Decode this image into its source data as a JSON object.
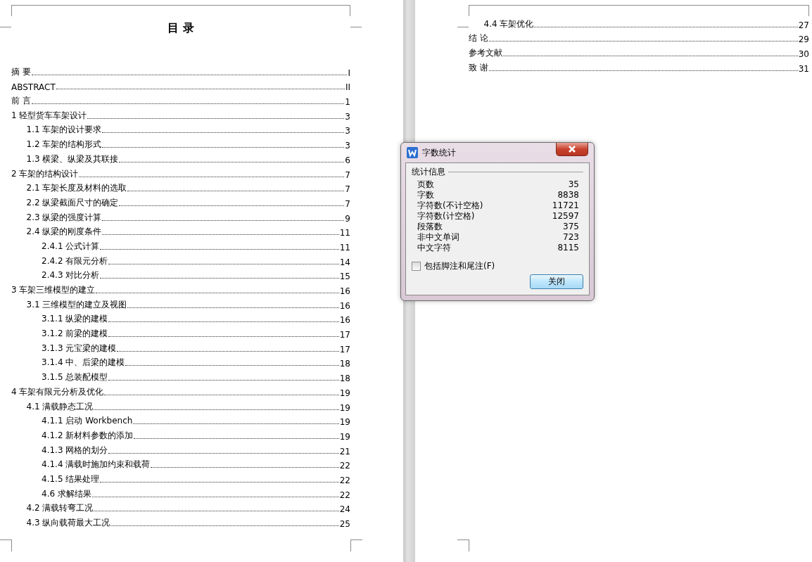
{
  "pages": [
    {
      "title": "目 录",
      "entries": [
        {
          "label": "摘 要",
          "page": "I"
        },
        {
          "label": "ABSTRACT",
          "page": "II"
        },
        {
          "label": "前 言",
          "page": "1"
        },
        {
          "label": "1 轻型货车车架设计",
          "page": "3",
          "children": [
            {
              "label": "1.1 车架的设计要求",
              "page": "3"
            },
            {
              "label": "1.2 车架的结构形式",
              "page": "3"
            },
            {
              "label": "1.3 横梁、纵梁及其联接",
              "page": "6"
            }
          ]
        },
        {
          "label": "2 车架的结构设计",
          "page": "7",
          "children": [
            {
              "label": "2.1 车架长度及材料的选取",
              "page": "7"
            },
            {
              "label": "2.2 纵梁截面尺寸的确定",
              "page": "7"
            },
            {
              "label": "2.3 纵梁的强度计算",
              "page": "9"
            },
            {
              "label": "2.4 纵梁的刚度条件",
              "page": "11",
              "children": [
                {
                  "label": "2.4.1 公式计算",
                  "page": "11"
                },
                {
                  "label": "2.4.2 有限元分析",
                  "page": "14"
                },
                {
                  "label": "2.4.3 对比分析",
                  "page": "15"
                }
              ]
            }
          ]
        },
        {
          "label": "3 车架三维模型的建立",
          "page": "16",
          "children": [
            {
              "label": "3.1 三维模型的建立及视图",
              "page": "16",
              "children": [
                {
                  "label": "3.1.1 纵梁的建模",
                  "page": "16"
                },
                {
                  "label": "3.1.2 前梁的建模",
                  "page": "17"
                },
                {
                  "label": "3.1.3 元宝梁的建模",
                  "page": "17"
                },
                {
                  "label": "3.1.4 中、后梁的建模",
                  "page": "18"
                },
                {
                  "label": "3.1.5 总装配模型",
                  "page": "18"
                }
              ]
            }
          ]
        },
        {
          "label": "4 车架有限元分析及优化",
          "page": "19",
          "children": [
            {
              "label": "4.1 满载静态工况",
              "page": "19",
              "children": [
                {
                  "label": "4.1.1 启动 Workbench",
                  "page": "19"
                },
                {
                  "label": "4.1.2 新材料参数的添加",
                  "page": "19"
                },
                {
                  "label": "4.1.3 网格的划分",
                  "page": "21"
                },
                {
                  "label": "4.1.4 满载时施加约束和载荷",
                  "page": "22"
                },
                {
                  "label": "4.1.5 结果处理",
                  "page": "22"
                },
                {
                  "label": "4.6 求解结果",
                  "page": "22"
                }
              ]
            },
            {
              "label": "4.2 满载转弯工况",
              "page": "24"
            },
            {
              "label": "4.3 纵向载荷最大工况",
              "page": "25"
            }
          ]
        }
      ]
    },
    {
      "entries": [
        {
          "children": [
            {
              "label": "4.4 车架优化",
              "page": "27"
            }
          ]
        },
        {
          "label": "结 论",
          "page": "29"
        },
        {
          "label": "参考文献",
          "page": "30"
        },
        {
          "label": "致 谢",
          "page": "31"
        }
      ]
    }
  ],
  "dialog": {
    "title": "字数统计",
    "group": "统计信息",
    "stats": [
      {
        "label": "页数",
        "value": "35"
      },
      {
        "label": "字数",
        "value": "8838"
      },
      {
        "label": "字符数(不计空格)",
        "value": "11721"
      },
      {
        "label": "字符数(计空格)",
        "value": "12597"
      },
      {
        "label": "段落数",
        "value": "375"
      },
      {
        "label": "非中文单词",
        "value": "723"
      },
      {
        "label": "中文字符",
        "value": "8115"
      }
    ],
    "checkbox": {
      "label": "包括脚注和尾注(F)",
      "checked": false
    },
    "button": "关闭"
  }
}
